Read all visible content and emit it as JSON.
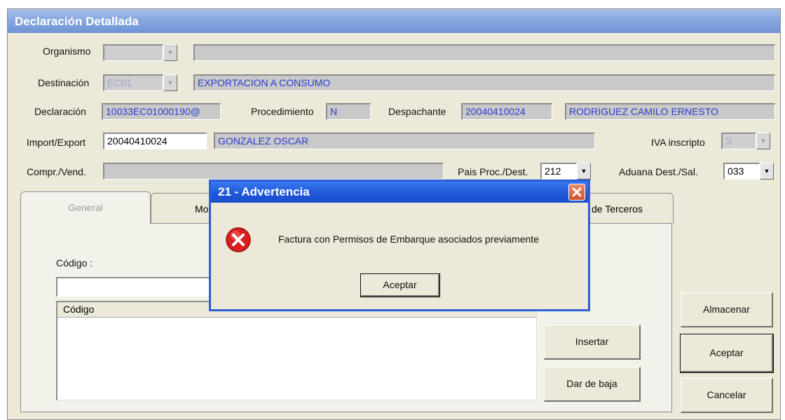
{
  "window": {
    "title": "Declaración Detallada"
  },
  "form": {
    "organismo": {
      "label": "Organismo",
      "code": "",
      "desc": ""
    },
    "destinacion": {
      "label": "Destinación",
      "code": "EC01",
      "desc": "EXPORTACION A CONSUMO"
    },
    "declaracion": {
      "label": "Declaración",
      "value": "10033EC01000190@"
    },
    "procedimiento": {
      "label": "Procedimiento",
      "value": "N"
    },
    "despachante": {
      "label": "Despachante",
      "cuit": "20040410024",
      "name": "RODRIGUEZ CAMILO ERNESTO"
    },
    "import_export": {
      "label": "Import/Export",
      "cuit": "20040410024",
      "name": "GONZALEZ OSCAR"
    },
    "iva": {
      "label": "IVA inscripto",
      "value": "S"
    },
    "compr_vend": {
      "label": "Compr./Vend.",
      "value": ""
    },
    "pais": {
      "label": "Pais Proc./Dest.",
      "value": "212"
    },
    "aduana": {
      "label": "Aduana Dest./Sal.",
      "value": "033"
    }
  },
  "tabs": [
    {
      "label": "General"
    },
    {
      "label": "Mo"
    },
    {
      "label": "de Terceros"
    }
  ],
  "panel": {
    "codigo_label": "Código :",
    "codigo_value": "",
    "list_header": "Código",
    "insertar": "Insertar",
    "dar_de_baja": "Dar de baja"
  },
  "side_buttons": {
    "almacenar": "Almacenar",
    "aceptar": "Aceptar",
    "cancelar": "Cancelar"
  },
  "dialog": {
    "title": "21 - Advertencia",
    "message": "Factura con Permisos de Embarque asociados previamente",
    "ok": "Aceptar",
    "icon": "error-icon"
  },
  "colors": {
    "title_bar": "#7f9fdc",
    "dialog_title": "#1f56d8",
    "field_text": "#2a3ccc"
  }
}
